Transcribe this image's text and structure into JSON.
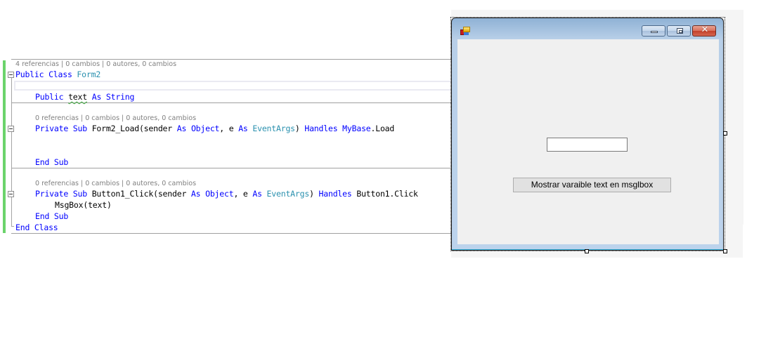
{
  "editor": {
    "lenses": {
      "class": "4 referencias | 0 cambios | 0 autores, 0 cambios",
      "form_load": "0 referencias | 0 cambios | 0 autores, 0 cambios",
      "button_click": "0 referencias | 0 cambios | 0 autores, 0 cambios"
    },
    "code": {
      "class_kw": "Public Class",
      "class_name": "Form2",
      "field_public": "Public",
      "field_name": "text",
      "field_as": "As",
      "field_type": "String",
      "load_kw1": "Private Sub",
      "load_name": "Form2_Load(sender",
      "load_as1": "As",
      "load_obj": "Object",
      "load_e": ", e",
      "load_as2": "As",
      "load_args": "EventArgs",
      "load_paren": ")",
      "load_handles": "Handles",
      "load_mybase": "MyBase",
      "load_event": ".Load",
      "end_sub_1": "End Sub",
      "click_kw1": "Private Sub",
      "click_name": "Button1_Click(sender",
      "click_as1": "As",
      "click_obj": "Object",
      "click_e": ", e",
      "click_as2": "As",
      "click_args": "EventArgs",
      "click_paren": ")",
      "click_handles": "Handles",
      "click_event": "Button1.Click",
      "msgbox": "MsgBox(text)",
      "end_sub_2": "End Sub",
      "end_class": "End Class"
    }
  },
  "designer": {
    "form": {
      "title": "",
      "textbox_value": "",
      "button_label": "Mostrar varaible text en msglbox"
    },
    "title_buttons": {
      "minimize": "minimize",
      "maximize": "maximize",
      "close": "✕"
    }
  }
}
